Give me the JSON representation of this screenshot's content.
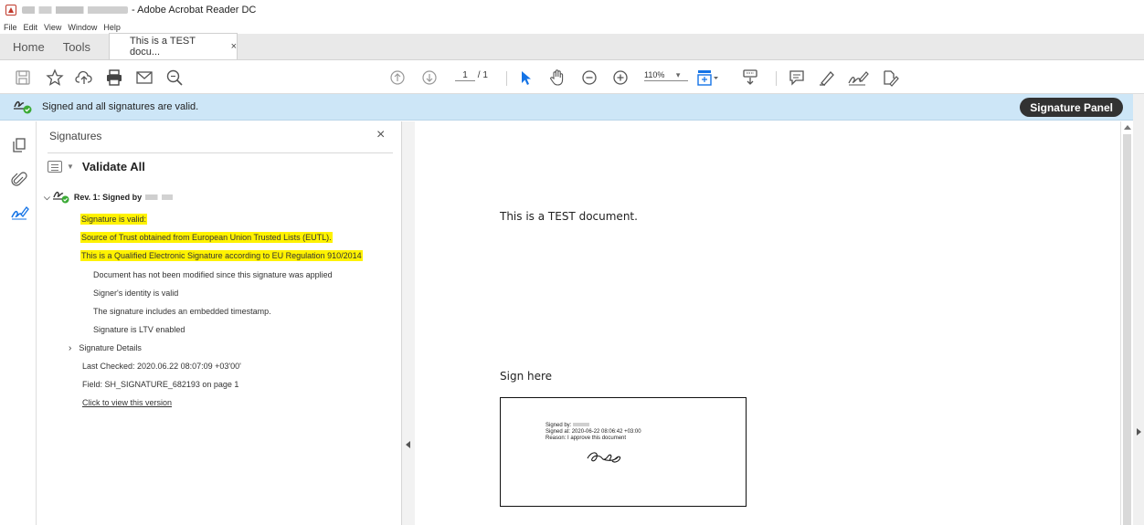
{
  "window": {
    "title_suffix": "- Adobe Acrobat Reader DC"
  },
  "menu": [
    "File",
    "Edit",
    "View",
    "Window",
    "Help"
  ],
  "tabs": {
    "home": "Home",
    "tools": "Tools",
    "doc": "This is a TEST docu...",
    "close": "×"
  },
  "toolbar": {
    "page_current": "1",
    "page_total": "/ 1",
    "zoom": "110%",
    "zoom_caret": "▾"
  },
  "banner": {
    "message": "Signed and all signatures are valid.",
    "panel_button": "Signature Panel"
  },
  "panel": {
    "title": "Signatures",
    "close": "×",
    "validate_all": "Validate All",
    "revision": "Rev. 1: Signed by",
    "lines": {
      "valid": "Signature is valid:",
      "trust": "Source of Trust obtained from European Union Trusted Lists (EUTL).",
      "qualified": "This is a Qualified Electronic Signature according to EU Regulation 910/2014",
      "not_modified": "Document has not been modified since this signature was applied",
      "identity": "Signer's identity is valid",
      "timestamp": "The signature includes an embedded timestamp.",
      "ltv": "Signature is LTV enabled",
      "details": "Signature Details",
      "last_checked": "Last Checked: 2020.06.22 08:07:09 +03'00'",
      "field": "Field: SH_SIGNATURE_682193 on page 1",
      "view_version": "Click to view this version"
    }
  },
  "document": {
    "heading": "This is a TEST document.",
    "sign_here": "Sign here",
    "stamp": {
      "signed_by": "Signed by:",
      "signed_at": "Signed at: 2020-06-22 08:06:42 +03:00",
      "reason": "Reason: I approve this document"
    }
  },
  "colors": {
    "banner_bg": "#cde6f7",
    "highlight": "#fff200",
    "valid_green": "#3aaa35",
    "button_dark": "#323232"
  }
}
